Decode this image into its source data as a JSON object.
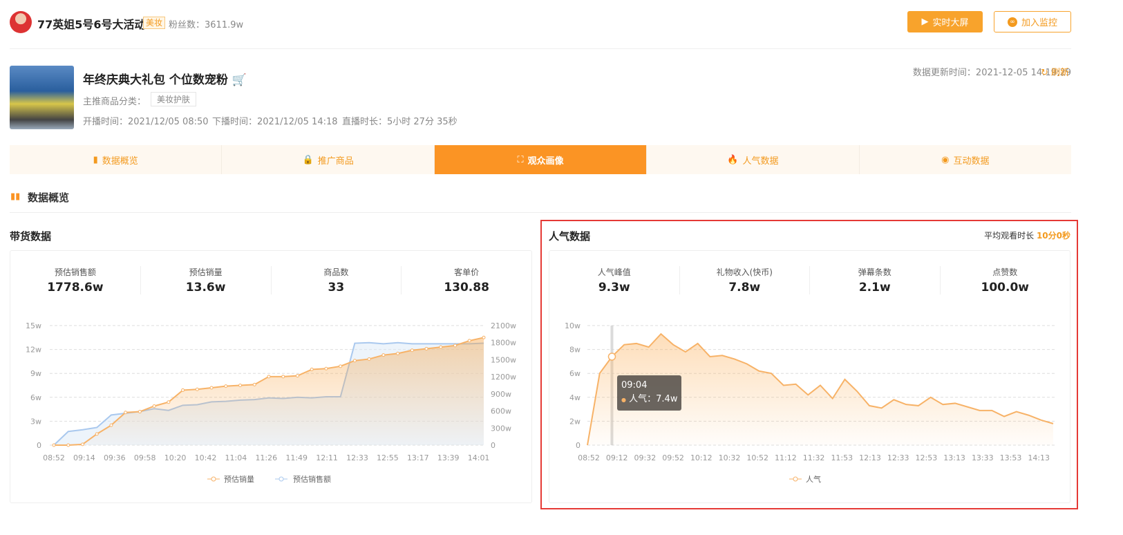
{
  "header": {
    "anchor_name": "77英姐5号6号大活动",
    "tag": "美妆",
    "fans_label": "粉丝数：",
    "fans_value": "3611.9w",
    "btn_screen": "实时大屏",
    "btn_monitor": "加入监控"
  },
  "live": {
    "title": "年终庆典大礼包 个位数宠粉",
    "category_label": "主推商品分类：",
    "category": "美妆护肤",
    "start": "开播时间：2021/12/05 08:50",
    "end": "下播时间：2021/12/05 14:18",
    "duration": "直播时长：5小时 27分 35秒",
    "update_time": "数据更新时间：2021-12-05 14:19:29",
    "refresh": "刷新"
  },
  "tabs": [
    {
      "label": "数据概览",
      "icon": "bar-chart-icon"
    },
    {
      "label": "推广商品",
      "icon": "bag-icon"
    },
    {
      "label": "观众画像",
      "icon": "portrait-icon",
      "active": true
    },
    {
      "label": "人气数据",
      "icon": "fire-icon"
    },
    {
      "label": "互动数据",
      "icon": "pulse-icon"
    }
  ],
  "section_title": "数据概览",
  "sales": {
    "title": "带货数据",
    "stats": [
      {
        "label": "预估销售额",
        "value": "1778.6w"
      },
      {
        "label": "预估销量",
        "value": "13.6w"
      },
      {
        "label": "商品数",
        "value": "33"
      },
      {
        "label": "客单价",
        "value": "130.88"
      }
    ]
  },
  "popularity": {
    "title": "人气数据",
    "avg_label": "平均观看时长",
    "avg_value": "10分0秒",
    "stats": [
      {
        "label": "人气峰值",
        "value": "9.3w"
      },
      {
        "label": "礼物收入(快币)",
        "value": "7.8w"
      },
      {
        "label": "弹幕条数",
        "value": "2.1w"
      },
      {
        "label": "点赞数",
        "value": "100.0w"
      }
    ]
  },
  "colors": {
    "accent": "#fb9424",
    "orange_line": "#f7b267",
    "blue_line": "#a9c8ee",
    "highlight": "#e53935"
  },
  "chart_data": [
    {
      "type": "line",
      "title": "带货数据",
      "x_labels": [
        "08:52",
        "09:14",
        "09:36",
        "09:58",
        "10:20",
        "10:42",
        "11:04",
        "11:26",
        "11:49",
        "12:11",
        "12:33",
        "12:55",
        "13:17",
        "13:39",
        "14:01"
      ],
      "y_ticks_left": [
        "0",
        "3w",
        "6w",
        "9w",
        "12w",
        "15w"
      ],
      "ylim_left": [
        0,
        15
      ],
      "y_ticks_right": [
        "0",
        "300w",
        "600w",
        "900w",
        "1200w",
        "1500w",
        "1800w",
        "2100w"
      ],
      "ylim_right": [
        0,
        2100
      ],
      "legend": [
        "预估销量",
        "预估销售额"
      ],
      "legend_position": "bottom",
      "series": [
        {
          "name": "预估销量",
          "axis": "left",
          "values": [
            0,
            0,
            0.1,
            1.4,
            2.5,
            4.1,
            4.2,
            4.9,
            5.4,
            6.9,
            7.0,
            7.2,
            7.4,
            7.5,
            7.6,
            8.6,
            8.6,
            8.7,
            9.5,
            9.6,
            9.9,
            10.6,
            10.8,
            11.3,
            11.5,
            11.9,
            12.1,
            12.3,
            12.5,
            13.1,
            13.5
          ]
        },
        {
          "name": "预估销售额",
          "axis": "right",
          "values": [
            0,
            240,
            270,
            310,
            530,
            560,
            590,
            640,
            610,
            700,
            710,
            760,
            770,
            790,
            800,
            830,
            820,
            840,
            830,
            850,
            850,
            1790,
            1800,
            1780,
            1800,
            1780,
            1780,
            1780,
            1780,
            1780,
            1790
          ]
        }
      ]
    },
    {
      "type": "area",
      "title": "人气数据",
      "x_labels": [
        "08:52",
        "09:12",
        "09:32",
        "09:52",
        "10:12",
        "10:32",
        "10:52",
        "11:12",
        "11:32",
        "11:53",
        "12:13",
        "12:33",
        "12:53",
        "13:13",
        "13:33",
        "13:53",
        "14:13"
      ],
      "y_ticks": [
        "0",
        "2w",
        "4w",
        "6w",
        "8w",
        "10w"
      ],
      "ylim": [
        0,
        10
      ],
      "legend": [
        "人气"
      ],
      "legend_position": "bottom",
      "series": [
        {
          "name": "人气",
          "values": [
            0,
            6,
            7.4,
            8.4,
            8.5,
            8.2,
            9.3,
            8.4,
            7.8,
            8.5,
            7.4,
            7.5,
            7.2,
            6.8,
            6.2,
            6.0,
            5.0,
            5.1,
            4.2,
            5.0,
            3.9,
            5.5,
            4.5,
            3.3,
            3.1,
            3.8,
            3.4,
            3.3,
            4.0,
            3.4,
            3.5,
            3.2,
            2.9,
            2.9,
            2.4,
            2.8,
            2.5,
            2.1,
            1.8
          ]
        }
      ],
      "tooltip": {
        "time": "09:04",
        "label": "人气：",
        "value": "7.4w",
        "index": 2
      }
    }
  ]
}
